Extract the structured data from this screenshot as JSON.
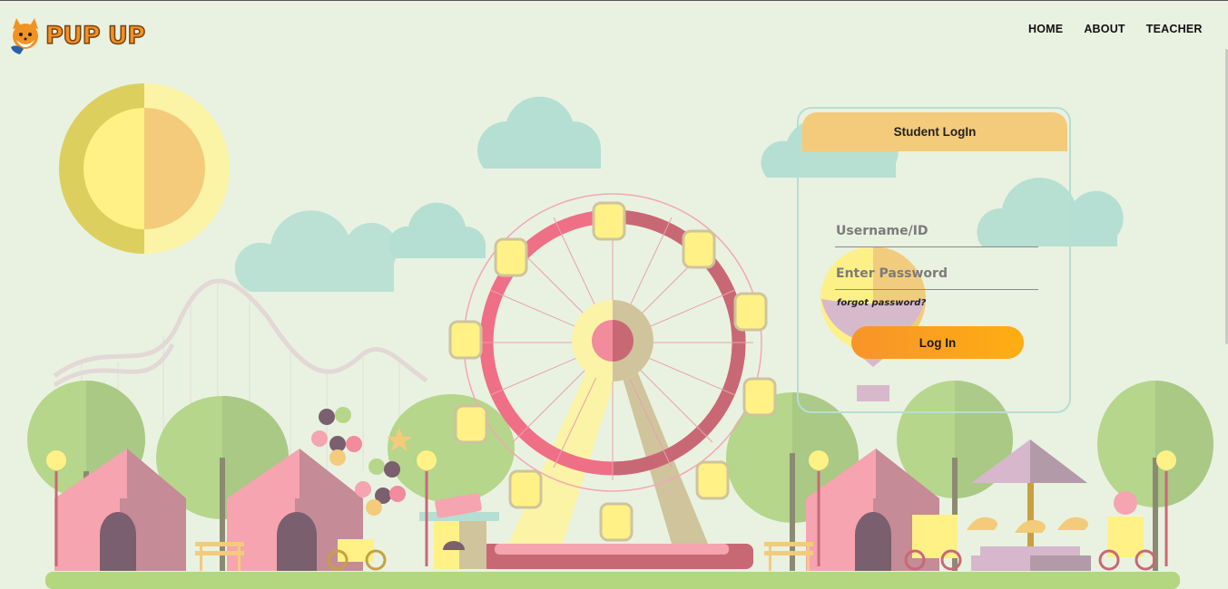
{
  "brand": {
    "name": "PUP UP",
    "logo_icon": "fox-mascot-icon"
  },
  "nav": {
    "items": [
      {
        "label": "HOME"
      },
      {
        "label": "ABOUT"
      },
      {
        "label": "TEACHER"
      }
    ]
  },
  "login": {
    "title": "Student LogIn",
    "username_placeholder": "Username/ID",
    "password_placeholder": "Enter Password",
    "forgot_label": "forgot password?",
    "submit_label": "Log In"
  },
  "colors": {
    "accent": "#f3cb7a",
    "button": "#ffa51f",
    "background": "#e9f2e1",
    "card_border": "#b7ded2"
  }
}
